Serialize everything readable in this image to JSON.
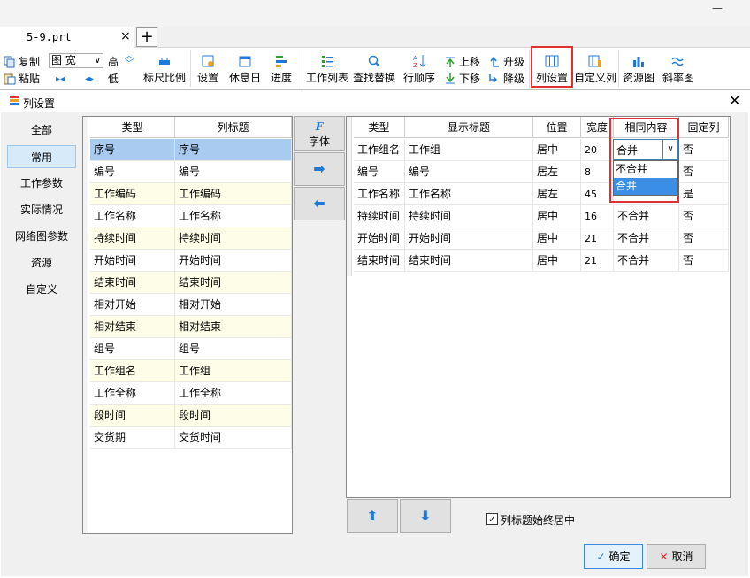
{
  "tab": {
    "title": "5-9.prt",
    "close": "×",
    "add": "+"
  },
  "ribbon": {
    "copy": "复制",
    "paste": "粘贴",
    "view_value": "图 宽",
    "high": "高",
    "low": "低",
    "ruler_scale": "标尺比例",
    "settings": "设置",
    "holiday": "休息日",
    "progress": "进度",
    "work_list": "工作列表",
    "find_replace": "查找替换",
    "row_order": "行顺序",
    "move_up": "上移",
    "move_down": "下移",
    "promote": "升级",
    "demote": "降级",
    "col_settings": "列设置",
    "custom_cols": "自定义列",
    "resource_chart": "资源图",
    "slope_chart": "斜率图"
  },
  "dialog": {
    "title": "列设置",
    "close": "✕",
    "nav": [
      "全部",
      "常用",
      "工作参数",
      "实际情况",
      "网络图参数",
      "资源",
      "自定义"
    ],
    "left_grid": {
      "headers": [
        "类型",
        "列标题"
      ],
      "rows": [
        [
          "序号",
          "序号"
        ],
        [
          "编号",
          "编号"
        ],
        [
          "工作编码",
          "工作编码"
        ],
        [
          "工作名称",
          "工作名称"
        ],
        [
          "持续时间",
          "持续时间"
        ],
        [
          "开始时间",
          "开始时间"
        ],
        [
          "结束时间",
          "结束时间"
        ],
        [
          "相对开始",
          "相对开始"
        ],
        [
          "相对结束",
          "相对结束"
        ],
        [
          "组号",
          "组号"
        ],
        [
          "工作组名",
          "工作组"
        ],
        [
          "工作全称",
          "工作全称"
        ],
        [
          "段时间",
          "段时间"
        ],
        [
          "交货期",
          "交货时间"
        ]
      ]
    },
    "font_button": "字体",
    "font_icon": "F",
    "right_grid": {
      "headers": [
        "类型",
        "显示标题",
        "位置",
        "宽度",
        "相同内容",
        "固定列"
      ],
      "rows": [
        [
          "工作组名",
          "工作组",
          "居中",
          "20",
          "合并",
          "否"
        ],
        [
          "编号",
          "编号",
          "居左",
          "8",
          "",
          "否"
        ],
        [
          "工作名称",
          "工作名称",
          "居左",
          "45",
          "",
          "是"
        ],
        [
          "持续时间",
          "持续时间",
          "居中",
          "16",
          "不合并",
          "否"
        ],
        [
          "开始时间",
          "开始时间",
          "居中",
          "21",
          "不合并",
          "否"
        ],
        [
          "结束时间",
          "结束时间",
          "居中",
          "21",
          "不合并",
          "否"
        ]
      ]
    },
    "combo": {
      "value": "合并",
      "options": [
        "不合并",
        "合并"
      ],
      "selected": 1
    },
    "center_title_checkbox": "列标题始终居中",
    "ok": "确定",
    "cancel": "取消"
  },
  "colors": {
    "accent": "#1f79d8",
    "highlight_row": "#a9cbef",
    "zebra": "#fdfde8",
    "red_box": "#e03030",
    "selected_option": "#3a8ee6"
  }
}
